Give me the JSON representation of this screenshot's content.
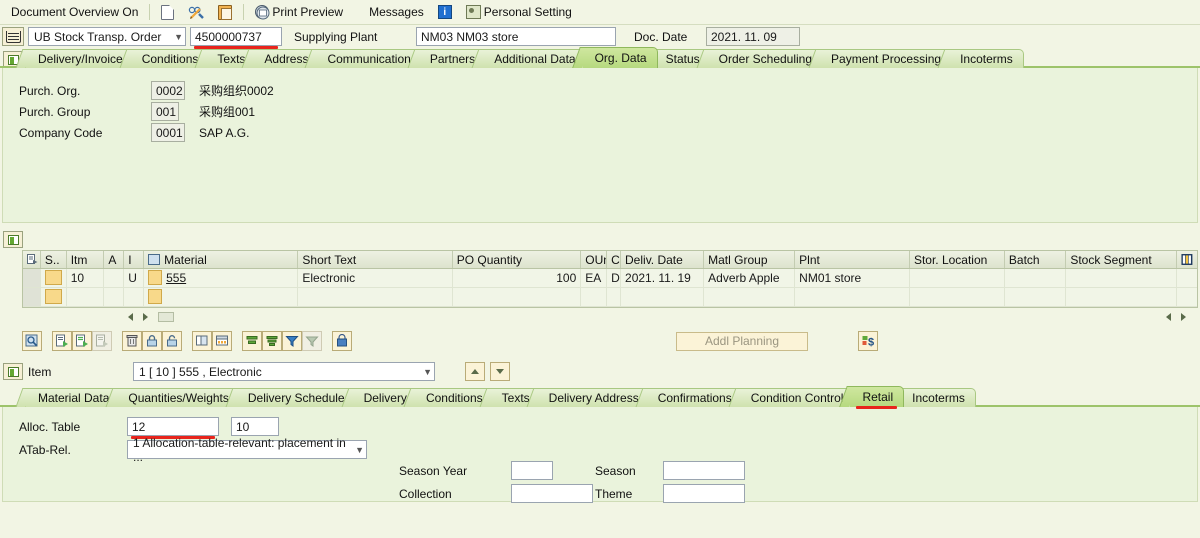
{
  "function_bar": {
    "items": [
      {
        "label": "Document Overview On",
        "icon": ""
      },
      {
        "label": "",
        "icon": "document-icon"
      },
      {
        "label": "",
        "icon": "display-change-icon"
      },
      {
        "label": "",
        "icon": "hold-clipboard-icon"
      },
      {
        "label": "Print Preview",
        "icon": "print-preview-icon"
      },
      {
        "label": "Messages",
        "icon": ""
      },
      {
        "label": "",
        "icon": "info-icon"
      },
      {
        "label": "Personal Setting",
        "icon": "personal-setting-icon"
      }
    ],
    "document_overview": "Document Overview On",
    "print_preview": "Print Preview",
    "messages": "Messages",
    "personal_setting": "Personal Setting"
  },
  "header": {
    "doc_type": "UB Stock Transp. Order",
    "doc_number": "4500000737",
    "supplying_plant_label": "Supplying Plant",
    "supplying_plant_value": "NM03 NM03 store",
    "doc_date_label": "Doc. Date",
    "doc_date_value": "2021. 11. 09"
  },
  "header_tabs": {
    "active": "Org. Data",
    "items": [
      "Delivery/Invoice",
      "Conditions",
      "Texts",
      "Address",
      "Communication",
      "Partners",
      "Additional Data",
      "Org. Data",
      "Status",
      "Order Scheduling",
      "Payment Processing",
      "Incoterms"
    ]
  },
  "org_data": {
    "rows": [
      {
        "label": "Purch. Org.",
        "value": "0002",
        "desc": "采购组织0002"
      },
      {
        "label": "Purch. Group",
        "value": "001",
        "desc": "采购组001"
      },
      {
        "label": "Company Code",
        "value": "0001",
        "desc": "SAP A.G."
      }
    ]
  },
  "item_grid": {
    "columns": [
      {
        "key": "sel",
        "label": ""
      },
      {
        "key": "status",
        "label": "S.."
      },
      {
        "key": "itm",
        "label": "Itm"
      },
      {
        "key": "a",
        "label": "A"
      },
      {
        "key": "i",
        "label": "I"
      },
      {
        "key": "material",
        "label": "Material"
      },
      {
        "key": "shorttext",
        "label": "Short Text"
      },
      {
        "key": "poqty",
        "label": "PO Quantity"
      },
      {
        "key": "oun",
        "label": "OUn"
      },
      {
        "key": "c",
        "label": "C"
      },
      {
        "key": "delivdate",
        "label": "Deliv. Date"
      },
      {
        "key": "matlgroup",
        "label": "Matl Group"
      },
      {
        "key": "plnt",
        "label": "Plnt"
      },
      {
        "key": "storloc",
        "label": "Stor. Location"
      },
      {
        "key": "batch",
        "label": "Batch"
      },
      {
        "key": "stockseg",
        "label": "Stock Segment"
      }
    ],
    "rows": [
      {
        "itm": "10",
        "a": "",
        "i": "U",
        "material": "555",
        "shorttext": "Electronic",
        "poqty": "100",
        "oun": "EA",
        "c": "D",
        "delivdate": "2021. 11. 19",
        "matlgroup": "Adverb Apple",
        "plnt": "NM01 store",
        "storloc": "",
        "batch": "",
        "stockseg": ""
      },
      {
        "itm": "",
        "a": "",
        "i": "",
        "material": "",
        "shorttext": "",
        "poqty": "",
        "oun": "",
        "c": "",
        "delivdate": "",
        "matlgroup": "",
        "plnt": "",
        "storloc": "",
        "batch": "",
        "stockseg": ""
      }
    ]
  },
  "item_toolbar": {
    "buttons": [
      {
        "name": "search-icon"
      },
      {
        "name": "insert-row-icon"
      },
      {
        "name": "copy-row-icon"
      },
      {
        "name": "paste-row-icon"
      },
      {
        "name": "delete-row-icon"
      },
      {
        "name": "lock-icon"
      },
      {
        "name": "unlock-icon"
      },
      {
        "name": "duplicate-icon"
      },
      {
        "name": "table-settings-icon"
      },
      {
        "name": "sort-ascending-icon"
      },
      {
        "name": "sort-descending-icon"
      },
      {
        "name": "filter-icon"
      },
      {
        "name": "print-table-icon"
      },
      {
        "name": "export-icon"
      },
      {
        "name": "config-icon"
      }
    ],
    "addl_planning_label": "Addl Planning",
    "currency_icon": "currency-icon"
  },
  "item_detail": {
    "item_label": "Item",
    "item_value": "1 [ 10 ] 555 , Electronic",
    "prev_icon": "previous-item-icon",
    "next_icon": "next-item-icon"
  },
  "item_tabs": {
    "active": "Retail",
    "items": [
      "Material Data",
      "Quantities/Weights",
      "Delivery Schedule",
      "Delivery",
      "Conditions",
      "Texts",
      "Delivery Address",
      "Confirmations",
      "Condition Control",
      "Retail",
      "Incoterms"
    ]
  },
  "retail": {
    "alloc_table_label": "Alloc. Table",
    "alloc_table_value": "12",
    "alloc_table_item_value": "10",
    "atab_rel_label": "ATab-Rel.",
    "atab_rel_value": "1 Allocation-table-relevant: placement in ...",
    "season_year_label": "Season Year",
    "season_year_value": "",
    "season_label": "Season",
    "season_value": "",
    "collection_label": "Collection",
    "collection_value": "",
    "theme_label": "Theme",
    "theme_value": ""
  },
  "annotations": {
    "color": "#e8241c",
    "targets": [
      "doc_number",
      "retail_tab",
      "alloc_table_value"
    ]
  }
}
